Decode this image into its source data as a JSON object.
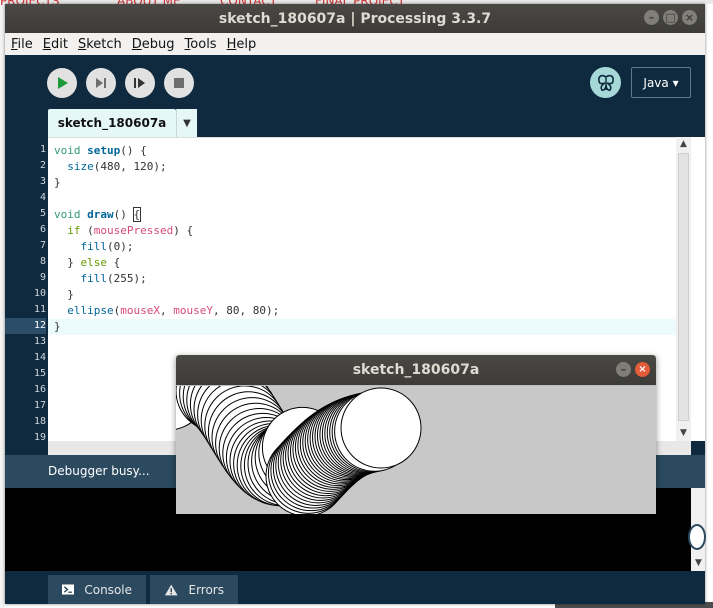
{
  "background": {
    "menu_fragments": [
      "PROJECTS",
      "ABOUT ME",
      "CONTACT",
      "FINAL PROJECT"
    ]
  },
  "window": {
    "title": "sketch_180607a | Processing 3.3.7",
    "controls": [
      "–",
      "□",
      "×"
    ]
  },
  "menubar": {
    "items": [
      {
        "first": "F",
        "rest": "ile"
      },
      {
        "first": "E",
        "rest": "dit"
      },
      {
        "first": "S",
        "rest": "ketch"
      },
      {
        "first": "D",
        "rest": "ebug"
      },
      {
        "first": "T",
        "rest": "ools"
      },
      {
        "first": "H",
        "rest": "elp"
      }
    ]
  },
  "toolbar": {
    "buttons": [
      "run-icon",
      "step-icon",
      "continue-icon",
      "stop-icon"
    ],
    "mode_icon": "debugger-butterfly-icon",
    "mode_label": "Java ▾"
  },
  "tabs": {
    "active_label": "sketch_180607a",
    "menu_arrow": "▼"
  },
  "editor": {
    "current_line": 12,
    "line_numbers": [
      "1",
      "2",
      "3",
      "4",
      "5",
      "6",
      "7",
      "8",
      "9",
      "10",
      "11",
      "12",
      "13",
      "14",
      "15",
      "16",
      "17",
      "18",
      "19"
    ],
    "lines": [
      [
        {
          "t": "void ",
          "c": "kw"
        },
        {
          "t": "setup",
          "c": "fn"
        },
        {
          "t": "() {",
          "c": ""
        }
      ],
      [
        {
          "t": "  ",
          "c": ""
        },
        {
          "t": "size",
          "c": "bf"
        },
        {
          "t": "(480, 120);",
          "c": ""
        }
      ],
      [
        {
          "t": "}",
          "c": ""
        }
      ],
      [
        {
          "t": "",
          "c": ""
        }
      ],
      [
        {
          "t": "void ",
          "c": "kw"
        },
        {
          "t": "draw",
          "c": "fn"
        },
        {
          "t": "() ",
          "c": ""
        },
        {
          "t": "{",
          "c": "caret-brace"
        }
      ],
      [
        {
          "t": "  ",
          "c": ""
        },
        {
          "t": "if",
          "c": "ctl"
        },
        {
          "t": " (",
          "c": ""
        },
        {
          "t": "mousePressed",
          "c": "sv"
        },
        {
          "t": ") {",
          "c": ""
        }
      ],
      [
        {
          "t": "    ",
          "c": ""
        },
        {
          "t": "fill",
          "c": "bf"
        },
        {
          "t": "(0);",
          "c": ""
        }
      ],
      [
        {
          "t": "  } ",
          "c": ""
        },
        {
          "t": "else",
          "c": "ctl"
        },
        {
          "t": " {",
          "c": ""
        }
      ],
      [
        {
          "t": "    ",
          "c": ""
        },
        {
          "t": "fill",
          "c": "bf"
        },
        {
          "t": "(255);",
          "c": ""
        }
      ],
      [
        {
          "t": "  }",
          "c": ""
        }
      ],
      [
        {
          "t": "  ",
          "c": ""
        },
        {
          "t": "ellipse",
          "c": "bf"
        },
        {
          "t": "(",
          "c": ""
        },
        {
          "t": "mouseX",
          "c": "sv"
        },
        {
          "t": ", ",
          "c": ""
        },
        {
          "t": "mouseY",
          "c": "sv"
        },
        {
          "t": ", 80, 80);",
          "c": ""
        }
      ],
      [
        {
          "t": "}",
          "c": ""
        }
      ]
    ]
  },
  "status": {
    "message": "Debugger busy..."
  },
  "bottom_tabs": [
    {
      "icon": "console-icon",
      "label": "Console"
    },
    {
      "icon": "warning-icon",
      "label": "Errors"
    }
  ],
  "sketch_window": {
    "title": "sketch_180607a",
    "controls": [
      "–",
      "×"
    ]
  },
  "colors": {
    "ide_dark": "#0f2a3f",
    "status_bar": "#2c4a5f",
    "tab_bg": "#e6f7f7",
    "current_line": "#ecfcfc",
    "canvas_bg": "#c8c8c8"
  }
}
